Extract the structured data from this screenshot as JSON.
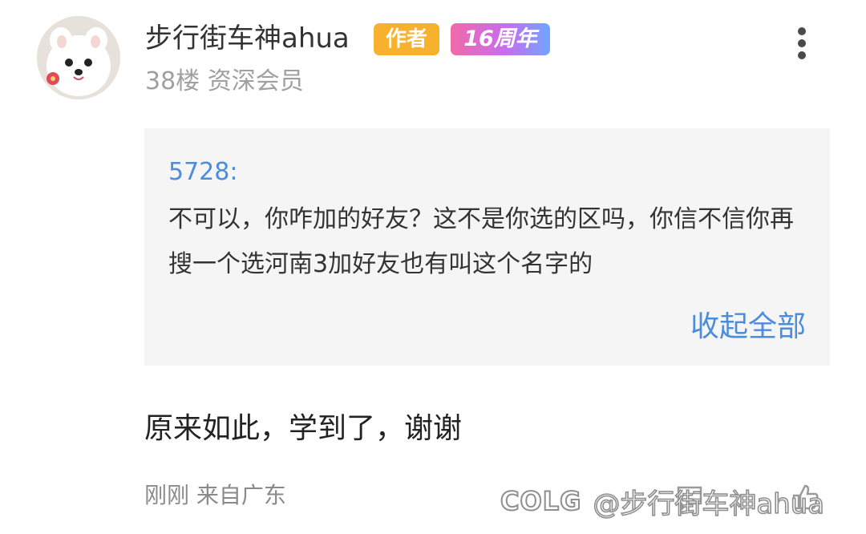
{
  "post": {
    "user": {
      "name": "步行街车神ahua",
      "author_badge": "作者",
      "anniversary_badge": "16周年",
      "floor_and_level": "38楼 资深会员",
      "avatar_icon": "white-dog-avatar-icon"
    },
    "quote": {
      "author": "5728:",
      "text": "不可以，你咋加的好友？这不是你选的区吗，你信不信你再搜一个选河南3加好友也有叫这个名字的",
      "collapse_label": "收起全部"
    },
    "reply_text": "原来如此，学到了，谢谢",
    "footer": {
      "time_location": "刚刚 来自广东"
    },
    "icons": {
      "more": "more-vertical-icon",
      "reply": "reply-icon",
      "like": "like-icon"
    }
  },
  "watermark": {
    "logo": "COLG",
    "handle": "@步行街车神ahua"
  },
  "colors": {
    "author_badge": "#f7b12f",
    "link": "#4a8ddc",
    "quote_bg": "#f5f5f5",
    "muted_text": "#a0a0a0"
  }
}
